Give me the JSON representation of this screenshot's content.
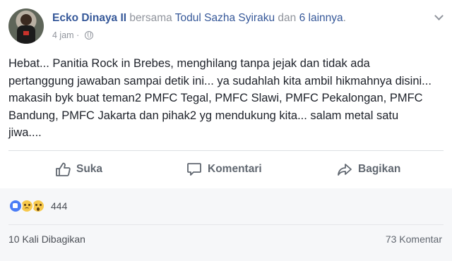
{
  "post": {
    "author": "Ecko Dinaya II",
    "with_word": "bersama",
    "tagged": "Todul Sazha Syiraku",
    "and_word": "dan",
    "others": "6 lainnya",
    "trailing": ".",
    "time": "4 jam",
    "separator": "·",
    "privacy_icon": "globe-icon",
    "text": "Hebat... Panitia Rock in Brebes, menghilang tanpa jejak dan tidak ada pertanggung jawaban sampai detik ini... ya sudahlah kita ambil hikmahnya disini... makasih byk buat teman2 PMFC Tegal, PMFC Slawi, PMFC Pekalongan, PMFC Bandung, PMFC Jakarta dan pihak2 yg mendukung kita... salam metal satu jiwa...."
  },
  "actions": {
    "like": "Suka",
    "comment": "Komentari",
    "share": "Bagikan"
  },
  "footer": {
    "reaction_icons": [
      "like-reaction-icon",
      "sad-reaction-icon",
      "wow-reaction-icon"
    ],
    "reaction_count": "444",
    "shares": "10 Kali Dibagikan",
    "comments": "73 Komentar"
  },
  "colors": {
    "link": "#365899",
    "muted": "#90949c",
    "action": "#606770",
    "footer_bg": "#f6f7f9"
  }
}
